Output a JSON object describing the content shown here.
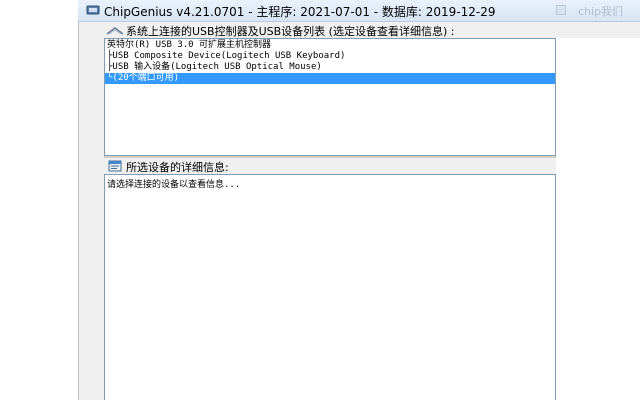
{
  "window": {
    "title": "ChipGenius v4.21.0701 - 主程序: 2021-07-01 - 数据库: 2019-12-29",
    "background_window_title": "chip我们"
  },
  "device_section": {
    "header_label": "系统上连接的USB控制器及USB设备列表 (选定设备查看详细信息) :",
    "icon": "usb-cable-icon",
    "items": [
      {
        "label": "英特尔(R) USB 3.0 可扩展主机控制器",
        "selected": false
      },
      {
        "label": "├USB Composite Device(Logitech USB Keyboard)",
        "selected": false
      },
      {
        "label": "├USB 输入设备(Logitech USB Optical Mouse)",
        "selected": false
      },
      {
        "label": "└(20个端口可用)",
        "selected": true
      }
    ]
  },
  "detail_section": {
    "header_label": "所选设备的详细信息:",
    "icon": "info-window-icon",
    "body_text": "请选择连接的设备以查看信息..."
  },
  "colors": {
    "selection": "#3399ff",
    "title_bar": "#dae6f4",
    "border": "#7f9db9"
  }
}
